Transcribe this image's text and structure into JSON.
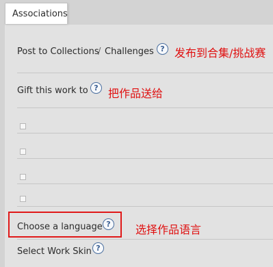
{
  "tab": {
    "label": "Associations"
  },
  "rows": {
    "collections": {
      "label": "Post to Collections",
      "separator": "/",
      "label2": "Challenges",
      "help": "?",
      "annotation": "发布到合集/挑战赛"
    },
    "gift": {
      "label": "Gift this work to",
      "help": "?",
      "annotation": "把作品送给"
    },
    "language": {
      "label": "Choose a language",
      "help": "?",
      "annotation": "选择作品语言"
    },
    "skin": {
      "label": "Select Work Skin",
      "help": "?"
    }
  },
  "checkboxes": [
    {
      "checked": false
    },
    {
      "checked": false
    },
    {
      "checked": false
    },
    {
      "checked": false
    }
  ],
  "colors": {
    "annotation": "#e01010",
    "highlight_border": "#e01818",
    "help_icon": "#3a5f93",
    "panel_bg": "#e2e2e2"
  }
}
